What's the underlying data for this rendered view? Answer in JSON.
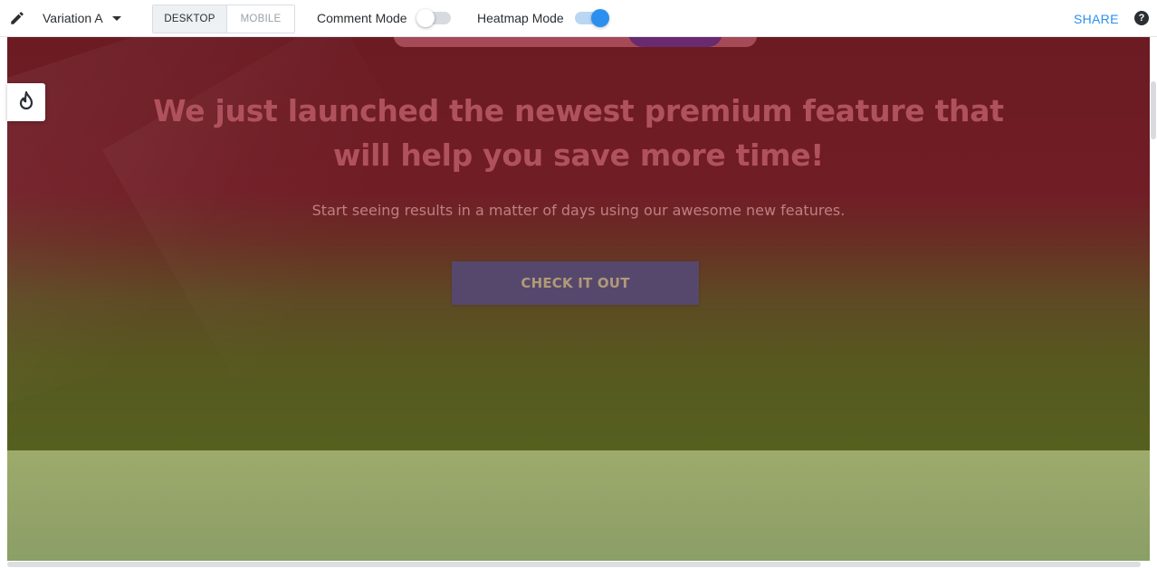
{
  "toolbar": {
    "edit_icon": "pencil-icon",
    "variation_label": "Variation A",
    "device_desktop": "DESKTOP",
    "device_mobile": "MOBILE",
    "active_device": "DESKTOP",
    "comment_mode_label": "Comment Mode",
    "comment_mode_on": false,
    "heatmap_mode_label": "Heatmap Mode",
    "heatmap_mode_on": true,
    "share_label": "SHARE",
    "help_icon": "question-circle-icon",
    "accent_color": "#2b8ff0"
  },
  "page": {
    "headline": "We just launched the newest premium feature that will help you save more time!",
    "subtext": "Start seeing results in a matter of days using our awesome new features.",
    "cta_label": "CHECK IT OUT"
  },
  "heatmap_button": {
    "icon": "flame-icon"
  }
}
